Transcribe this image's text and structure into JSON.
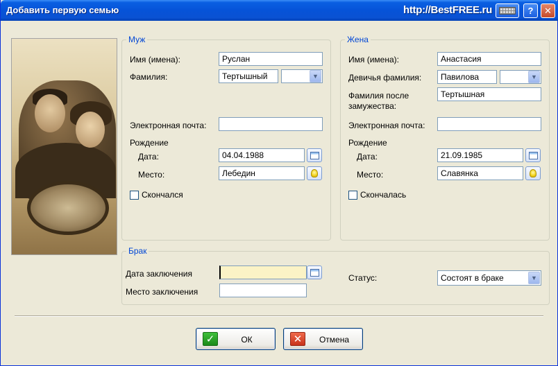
{
  "window": {
    "title": "Добавить первую семью",
    "brand": "http://BestFREE.ru",
    "help_label": "?",
    "close_label": "✕"
  },
  "husband": {
    "group_title": "Муж",
    "first_name_label": "Имя (имена):",
    "first_name_value": "Руслан",
    "last_name_label": "Фамилия:",
    "last_name_value": "Тертышный",
    "email_label": "Электронная почта:",
    "email_value": "",
    "birth_label": "Рождение",
    "date_label": "Дата:",
    "date_value": "04.04.1988",
    "place_label": "Место:",
    "place_value": "Лебедин",
    "deceased_label": "Скончался",
    "deceased_checked": false
  },
  "wife": {
    "group_title": "Жена",
    "first_name_label": "Имя (имена):",
    "first_name_value": "Анастасия",
    "maiden_name_label": "Девичья фамилия:",
    "maiden_name_value": "Павилова",
    "married_name_label_1": "Фамилия после",
    "married_name_label_2": "замужества:",
    "married_name_value": "Тертышная",
    "email_label": "Электронная почта:",
    "email_value": "",
    "birth_label": "Рождение",
    "date_label": "Дата:",
    "date_value": "21.09.1985",
    "place_label": "Место:",
    "place_value": "Славянка",
    "deceased_label": "Скончалась",
    "deceased_checked": false
  },
  "marriage": {
    "group_title": "Брак",
    "date_label": "Дата заключения",
    "date_value": "",
    "place_label": "Место заключения",
    "place_value": "",
    "status_label": "Статус:",
    "status_value": "Состоят в браке"
  },
  "buttons": {
    "ok_label": "ОК",
    "cancel_label": "Отмена"
  },
  "icons": {
    "ok": "check-icon",
    "cancel": "cross-icon",
    "calendar": "calendar-icon",
    "place": "lightbulb-icon",
    "keyboard": "keyboard-icon"
  },
  "colors": {
    "titlebar": "#0653d8",
    "group_title": "#0046d5",
    "ok_icon": "#1b8a19",
    "cancel_icon": "#c7321b",
    "highlighted_field": "#fbf3c6"
  }
}
